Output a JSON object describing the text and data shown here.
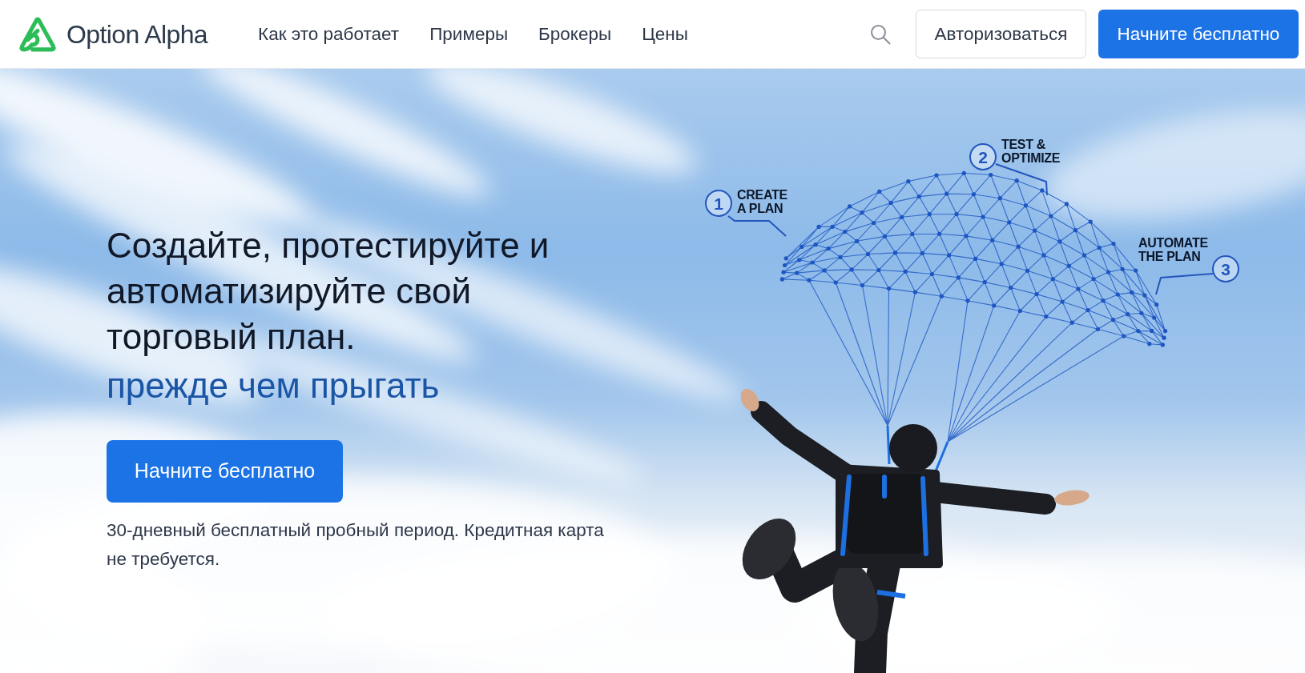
{
  "header": {
    "logo": "Option Alpha",
    "nav": [
      "Как это работает",
      "Примеры",
      "Брокеры",
      "Цены"
    ],
    "login_button": "Авторизоваться",
    "start_button": "Начните бесплатно"
  },
  "hero": {
    "heading": "Создайте, протестируйте и автоматизируйте свой торговый план.",
    "accent": "прежде чем прыгать",
    "cta_button": "Начните бесплатно",
    "note": "30-дневный бесплатный пробный период. Кредитная карта не требуется."
  },
  "diagram": {
    "steps": [
      {
        "number": "1",
        "label": "CREATE\nA PLAN"
      },
      {
        "number": "2",
        "label": "TEST &\nOPTIMIZE"
      },
      {
        "number": "3",
        "label": "AUTOMATE\nTHE PLAN"
      }
    ]
  }
}
